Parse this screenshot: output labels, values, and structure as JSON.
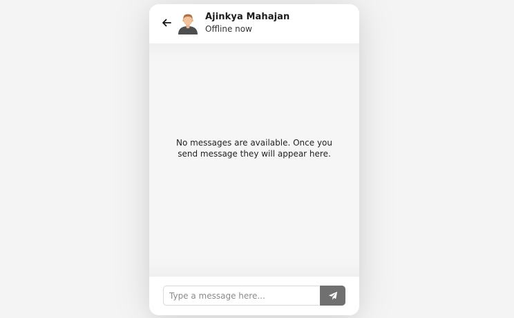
{
  "header": {
    "contact_name": "Ajinkya Mahajan",
    "status": "Offline now",
    "back_icon": "arrow-left-icon",
    "avatar_icon": "user-avatar"
  },
  "chat": {
    "empty_message": "No messages are available. Once you send message they will appear here."
  },
  "composer": {
    "placeholder": "Type a message here...",
    "value": "",
    "send_icon": "paper-plane-icon"
  },
  "colors": {
    "page_background": "#f4f4f4",
    "card_background": "#ffffff",
    "chat_background": "#f6f6f6",
    "send_button": "#707070",
    "text_primary": "#1d1d1d"
  }
}
